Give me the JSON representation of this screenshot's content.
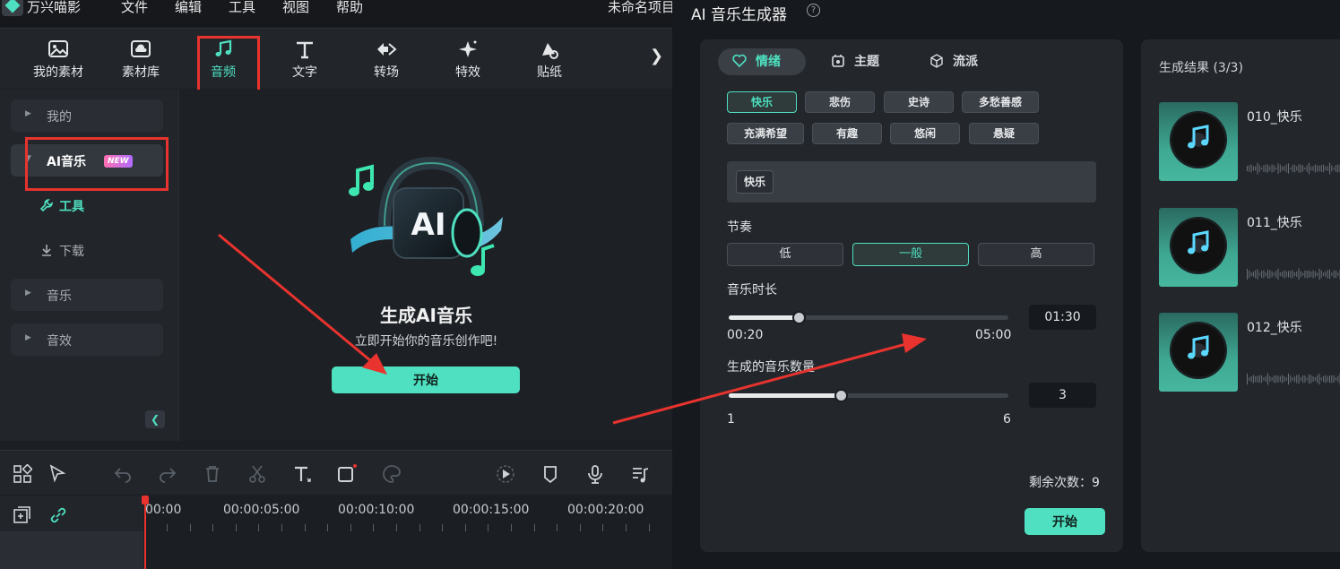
{
  "menubar": {
    "app_name": "万兴喵影",
    "items": [
      "文件",
      "编辑",
      "工具",
      "视图",
      "帮助"
    ],
    "project_title": "未命名项目"
  },
  "toolbar": {
    "tabs": [
      {
        "label": "我的素材",
        "icon": "image-icon"
      },
      {
        "label": "素材库",
        "icon": "cloud-library-icon"
      },
      {
        "label": "音频",
        "icon": "music-note-icon",
        "active": true
      },
      {
        "label": "文字",
        "icon": "text-icon"
      },
      {
        "label": "转场",
        "icon": "transition-icon"
      },
      {
        "label": "特效",
        "icon": "sparkle-icon"
      },
      {
        "label": "贴纸",
        "icon": "sticker-icon"
      }
    ],
    "next_glyph": "❯"
  },
  "sidebar": {
    "mine": "我的",
    "ai_music": "AI音乐",
    "new_badge": "NEW",
    "tools": "工具",
    "download": "下载",
    "music": "音乐",
    "sfx": "音效"
  },
  "hero": {
    "title": "生成AI音乐",
    "subtitle": "立即开始你的音乐创作吧!",
    "start": "开始",
    "ai_text": "AI"
  },
  "timeline": {
    "timecodes": [
      "00:00",
      "00:00:05:00",
      "00:00:10:00",
      "00:00:15:00",
      "00:00:20:00"
    ]
  },
  "dialog": {
    "title": "AI 音乐生成器",
    "help": "?",
    "tabs": [
      "情绪",
      "主题",
      "流派"
    ],
    "moods_row1": [
      "快乐",
      "悲伤",
      "史诗",
      "多愁善感"
    ],
    "moods_row2": [
      "充满希望",
      "有趣",
      "悠闲",
      "悬疑"
    ],
    "selected_mood": "快乐",
    "tempo_label": "节奏",
    "tempo_options": [
      "低",
      "一般",
      "高"
    ],
    "selected_tempo": "一般",
    "duration_label": "音乐时长",
    "duration_value": "01:30",
    "duration_min": "00:20",
    "duration_max": "05:00",
    "duration_progress": 0.25,
    "count_label": "生成的音乐数量",
    "count_value": "3",
    "count_min": "1",
    "count_max": "6",
    "count_progress": 0.4,
    "remaining": "剩余次数：9",
    "start": "开始"
  },
  "results": {
    "title": "生成结果 (3/3)",
    "items": [
      "010_快乐",
      "011_快乐",
      "012_快乐"
    ]
  },
  "colors": {
    "accent": "#4ee0c0",
    "highlight_red": "#e8332e"
  }
}
